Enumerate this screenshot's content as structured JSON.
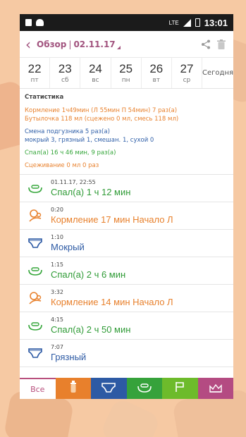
{
  "status_bar": {
    "time": "13:01",
    "network": "LTE"
  },
  "app_bar": {
    "title": "Обзор",
    "date": "02.11.17",
    "back_icon": "chevron-left-icon",
    "share_icon": "share-icon",
    "delete_icon": "trash-icon"
  },
  "days": [
    {
      "num": "22",
      "wd": "пт"
    },
    {
      "num": "23",
      "wd": "сб"
    },
    {
      "num": "24",
      "wd": "вс"
    },
    {
      "num": "25",
      "wd": "пн"
    },
    {
      "num": "26",
      "wd": "вт"
    },
    {
      "num": "27",
      "wd": "ср"
    }
  ],
  "today_label": "Сегодня",
  "stats": {
    "heading": "Статистика",
    "feeding": "Кормление 1ч49мин (Л 55мин  П 54мин)  7 раз(а)",
    "bottle": "Бутылочка 118 мл (сцежено 0 мл, смесь 118 мл)",
    "diaper": "Смена подгузника 5 раз(а)",
    "diaper_detail": "мокрый 3, грязный 1, смешан. 1, сухой 0",
    "sleep": "Спал(а) 16 ч 46 мин,  9 раз(а)",
    "pumping": "Сцеживание 0 мл 0 раз"
  },
  "entries": [
    {
      "time": "01.11.17, 22:55",
      "text": "Спал(а) 1 ч 12 мин",
      "icon": "sleep-icon"
    },
    {
      "time": "0:20",
      "text": "Кормление  17 мин Начало Л",
      "icon": "feeding-icon"
    },
    {
      "time": "1:10",
      "text": "Мокрый",
      "icon": "diaper-icon"
    },
    {
      "time": "1:15",
      "text": "Спал(а) 2 ч 6 мин",
      "icon": "sleep-icon"
    },
    {
      "time": "3:32",
      "text": "Кормление  14 мин Начало Л",
      "icon": "feeding-icon"
    },
    {
      "time": "4:15",
      "text": "Спал(а) 2 ч 50 мин",
      "icon": "sleep-icon"
    },
    {
      "time": "7:07",
      "text": "Грязный",
      "icon": "diaper-icon"
    }
  ],
  "tabs": [
    {
      "label": "Все"
    },
    {
      "icon": "bottle-icon"
    },
    {
      "icon": "diaper-icon"
    },
    {
      "icon": "sleep-icon"
    },
    {
      "icon": "flag-icon"
    },
    {
      "icon": "chart-icon"
    }
  ],
  "colors": {
    "accent": "#a2547f",
    "feeding": "#e8812d",
    "diaper": "#2d5aa4",
    "sleep": "#35a63a",
    "flag": "#6dbb2b",
    "chart": "#b44b82"
  }
}
